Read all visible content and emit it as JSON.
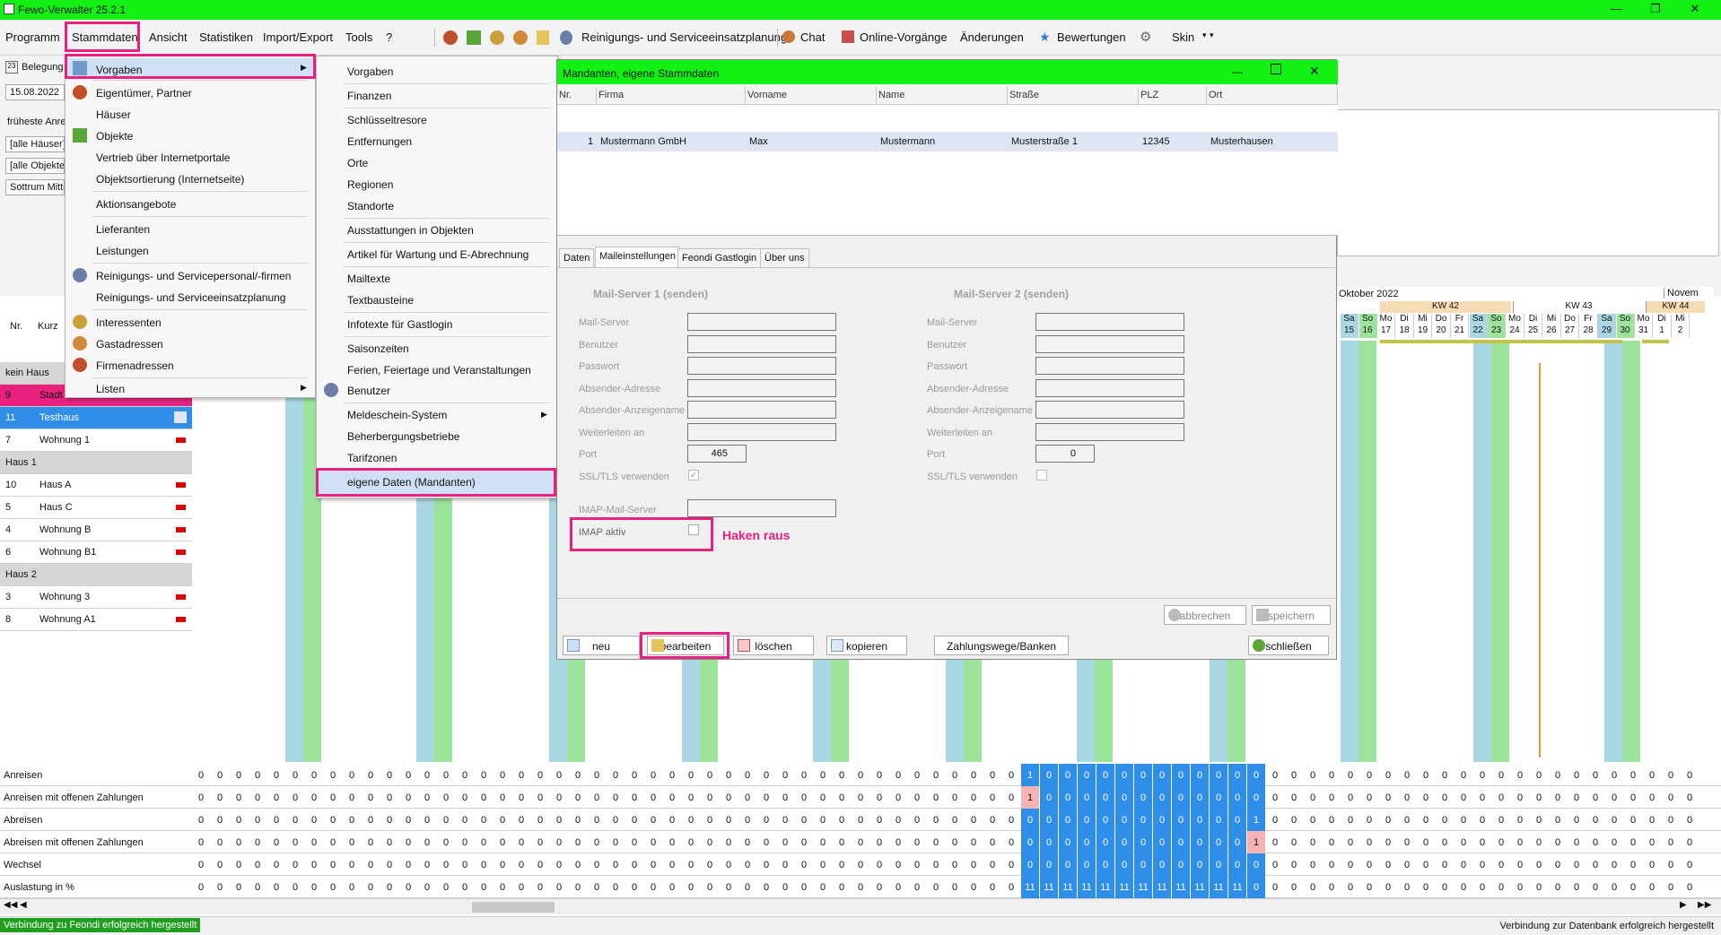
{
  "app": {
    "title": "Fewo-Verwalter 25.2.1"
  },
  "menubar": {
    "items": [
      "Programm",
      "Stammdaten",
      "Ansicht",
      "Statistiken",
      "Import/Export",
      "Tools",
      "?"
    ],
    "toolbar_items": [
      "Reinigungs- und Serviceeinsatzplanung",
      "Chat",
      "Online-Vorgänge",
      "Änderungen",
      "Bewertungen",
      "Skin"
    ]
  },
  "left_panel": {
    "belegung": "Belegung",
    "date": "15.08.2022",
    "frueheste": "früheste Anrei",
    "all_houses": "[alle Häuser]",
    "all_objects": "[alle Objekte]",
    "location": "Sottrum Mitte",
    "col_nr": "Nr.",
    "col_kurz": "Kurz"
  },
  "rows": [
    {
      "nr": "",
      "kurz": "kein Haus",
      "group": true
    },
    {
      "nr": "9",
      "kurz": "Stadt",
      "group": false,
      "style": "pink"
    },
    {
      "nr": "11",
      "kurz": "Testhaus",
      "group": false,
      "style": "blue"
    },
    {
      "nr": "7",
      "kurz": "Wohnung 1",
      "group": false
    },
    {
      "nr": "",
      "kurz": "Haus 1",
      "group": true
    },
    {
      "nr": "10",
      "kurz": "Haus A",
      "group": false
    },
    {
      "nr": "5",
      "kurz": "Haus C",
      "group": false
    },
    {
      "nr": "4",
      "kurz": "Wohnung B",
      "group": false
    },
    {
      "nr": "6",
      "kurz": "Wohnung B1",
      "group": false
    },
    {
      "nr": "",
      "kurz": "Haus 2",
      "group": true
    },
    {
      "nr": "3",
      "kurz": "Wohnung 3",
      "group": false
    },
    {
      "nr": "8",
      "kurz": "Wohnung A1",
      "group": false
    }
  ],
  "stammdaten_menu": {
    "items": [
      "Vorgaben",
      "Eigentümer, Partner",
      "Häuser",
      "Objekte",
      "Vertrieb über Internetportale",
      "Objektsortierung (Internetseite)",
      "Aktionsangebote",
      "Lieferanten",
      "Leistungen",
      "Reinigungs- und Servicepersonal/-firmen",
      "Reinigungs- und Serviceeinsatzplanung",
      "Interessenten",
      "Gastadressen",
      "Firmenadressen",
      "Listen"
    ]
  },
  "vorgaben_menu": {
    "items": [
      "Vorgaben",
      "Finanzen",
      "Schlüsseltresore",
      "Entfernungen",
      "Orte",
      "Regionen",
      "Standorte",
      "Ausstattungen in Objekten",
      "Artikel für Wartung und E-Abrechnung",
      "Mailtexte",
      "Textbausteine",
      "Infotexte für Gastlogin",
      "Saisonzeiten",
      "Ferien, Feiertage und Veranstaltungen",
      "Benutzer",
      "Meldeschein-System",
      "Beherbergungsbetriebe",
      "Tarifzonen",
      "eigene Daten (Mandanten)"
    ]
  },
  "dialog": {
    "title": "Mandanten, eigene Stammdaten",
    "columns": [
      "Nr.",
      "Firma",
      "Vorname",
      "Name",
      "Straße",
      "PLZ",
      "Ort"
    ],
    "record": [
      "1",
      "Mustermann GmbH",
      "Max",
      "Mustermann",
      "Musterstraße 1",
      "12345",
      "Musterhausen"
    ],
    "tabs": [
      "Daten",
      "Maileinstellungen",
      "Feondi Gastlogin",
      "Über uns"
    ],
    "server1_title": "Mail-Server 1 (senden)",
    "server2_title": "Mail-Server 2 (senden)",
    "fields": [
      "Mail-Server",
      "Benutzer",
      "Passwort",
      "Absender-Adresse",
      "Absender-Anzeigename",
      "Weiterleiten an",
      "Port",
      "SSL/TLS verwenden"
    ],
    "port1": "465",
    "port2": "0",
    "imap_server": "IMAP-Mail-Server",
    "imap_active": "IMAP aktiv",
    "annotation": "Haken raus",
    "btn_cancel": "abbrechen",
    "btn_save": "speichern",
    "btn_new": "neu",
    "btn_edit": "bearbeiten",
    "btn_delete": "löschen",
    "btn_copy": "kopieren",
    "btn_payment": "Zahlungswege/Banken",
    "btn_close": "schließen"
  },
  "calendar": {
    "month": "Oktober 2022",
    "next_month": "Novem",
    "weeks": [
      "KW 42",
      "KW 43",
      "KW 44"
    ],
    "days": [
      "Sa",
      "So",
      "Mo",
      "Di",
      "Mi",
      "Do",
      "Fr",
      "Sa",
      "So",
      "Mo",
      "Di",
      "Mi",
      "Do",
      "Fr",
      "Sa",
      "So",
      "Mo",
      "Di",
      "Mi"
    ],
    "dates": [
      "15",
      "16",
      "17",
      "18",
      "19",
      "20",
      "21",
      "22",
      "23",
      "24",
      "25",
      "26",
      "27",
      "28",
      "29",
      "30",
      "31",
      "1",
      "2"
    ]
  },
  "counters": {
    "labels": [
      "Anreisen",
      "Anreisen mit offenen Zahlungen",
      "Abreisen",
      "Abreisen mit offenen Zahlungen",
      "Wechsel",
      "Auslastung in %"
    ]
  },
  "status": {
    "left": "Verbindung zu Feondi erfolgreich hergestellt",
    "right": "Verbindung zur Datenbank erfolgreich hergestellt"
  }
}
